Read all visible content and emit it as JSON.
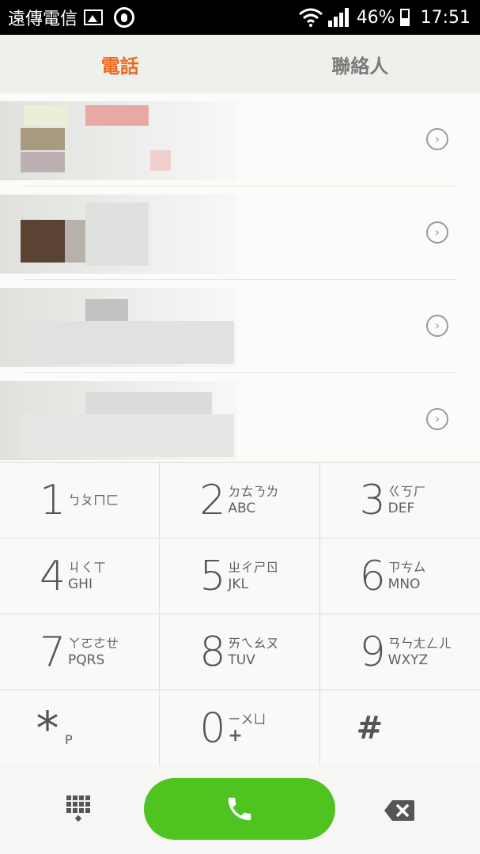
{
  "status_bar": {
    "carrier": "遠傳電信",
    "battery_percent": "46%",
    "time": "17:51"
  },
  "tabs": [
    {
      "label": "電話",
      "active": true
    },
    {
      "label": "聯絡人",
      "active": false
    }
  ],
  "keypad": [
    {
      "digit": "1",
      "bopomofo": "ㄅㄆㄇㄈ",
      "letters": ""
    },
    {
      "digit": "2",
      "bopomofo": "ㄉㄊㄋㄌ",
      "letters": "ABC"
    },
    {
      "digit": "3",
      "bopomofo": "ㄍㄎㄏ",
      "letters": "DEF"
    },
    {
      "digit": "4",
      "bopomofo": "ㄐㄑㄒ",
      "letters": "GHI"
    },
    {
      "digit": "5",
      "bopomofo": "ㄓㄔㄕㄖ",
      "letters": "JKL"
    },
    {
      "digit": "6",
      "bopomofo": "ㄗㄘㄙ",
      "letters": "MNO"
    },
    {
      "digit": "7",
      "bopomofo": "ㄚㄛㄜㄝ",
      "letters": "PQRS"
    },
    {
      "digit": "8",
      "bopomofo": "ㄞㄟㄠㄡ",
      "letters": "TUV"
    },
    {
      "digit": "9",
      "bopomofo": "ㄢㄣㄤㄥㄦ",
      "letters": "WXYZ"
    },
    {
      "digit": "*",
      "bopomofo": "",
      "letters": "P"
    },
    {
      "digit": "0",
      "bopomofo": "ㄧㄨㄩ",
      "letters": "+"
    },
    {
      "digit": "#",
      "bopomofo": "",
      "letters": ""
    }
  ],
  "icons": {
    "gallery": "gallery-icon",
    "notification": "notification-icon",
    "wifi": "wifi-icon",
    "signal": "signal-icon",
    "battery": "battery-icon",
    "call_detail": "chevron-right-circle-icon",
    "dialpad": "dialpad-icon",
    "call": "phone-icon",
    "backspace": "backspace-icon"
  },
  "colors": {
    "active_tab": "#ec6a1f",
    "call_button": "#4fc320"
  },
  "battery_level": 0.46
}
